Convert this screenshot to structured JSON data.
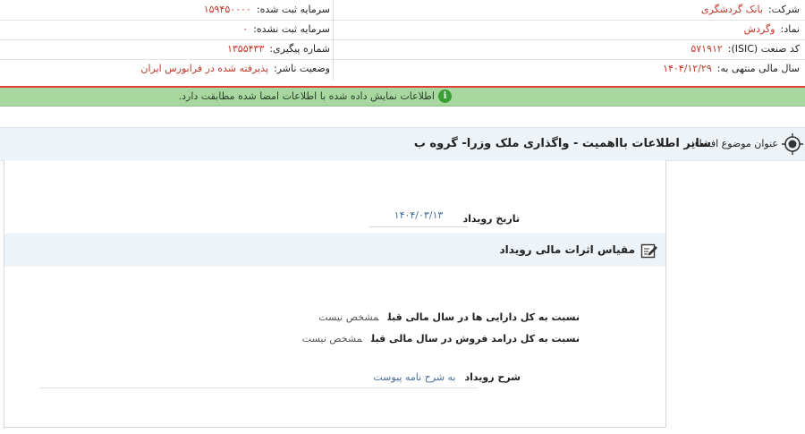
{
  "info": {
    "company_label": "شرکت:",
    "company_value": "بانک گردشگری",
    "symbol_label": "نماد:",
    "symbol_value": "وگردش",
    "isic_label": "کد صنعت (ISIC):",
    "isic_value": "۵۷۱۹۱۲",
    "fiscal_label": "سال مالی منتهی به:",
    "fiscal_value": "۱۴۰۴/۱۲/۲۹",
    "registered_capital_label": "سرمایه ثبت شده:",
    "registered_capital_value": "۱۵۹۴۵۰۰۰۰",
    "unregistered_capital_label": "سرمایه ثبت نشده:",
    "unregistered_capital_value": "۰",
    "tracking_label": "شماره پیگیری:",
    "tracking_value": "۱۳۵۵۴۳۳",
    "publisher_status_label": "وضعیت ناشر:",
    "publisher_status_value": "پذیرفته شده در فرابورس ایران"
  },
  "alert": {
    "text": "اطلاعات نمایش داده شده با اطلاعات امضا شده مطابقت دارد.",
    "icon": "info-icon",
    "color": "#a8d8a0"
  },
  "subject": {
    "label": "عنوان موضوع افشاء:",
    "title": "سایر اطلاعات بااهمیت - واگذاری ملک وزرا- گروه ب"
  },
  "event": {
    "date_label": "تاریخ رویداد",
    "date_value": "۱۴۰۴/۰۳/۱۳",
    "section_title": "مقیاس اثرات مالی رویداد",
    "assets_label": "نسبت به کل دارایی ها در سال مالی قبل",
    "assets_value": "مشخص نیست",
    "revenue_label": "نسبت به کل درامد فروش در سال مالی قبل",
    "revenue_value": "مشخص نیست",
    "description_label": "شرح رویداد",
    "description_value": "به شرح نامه پیوست"
  }
}
